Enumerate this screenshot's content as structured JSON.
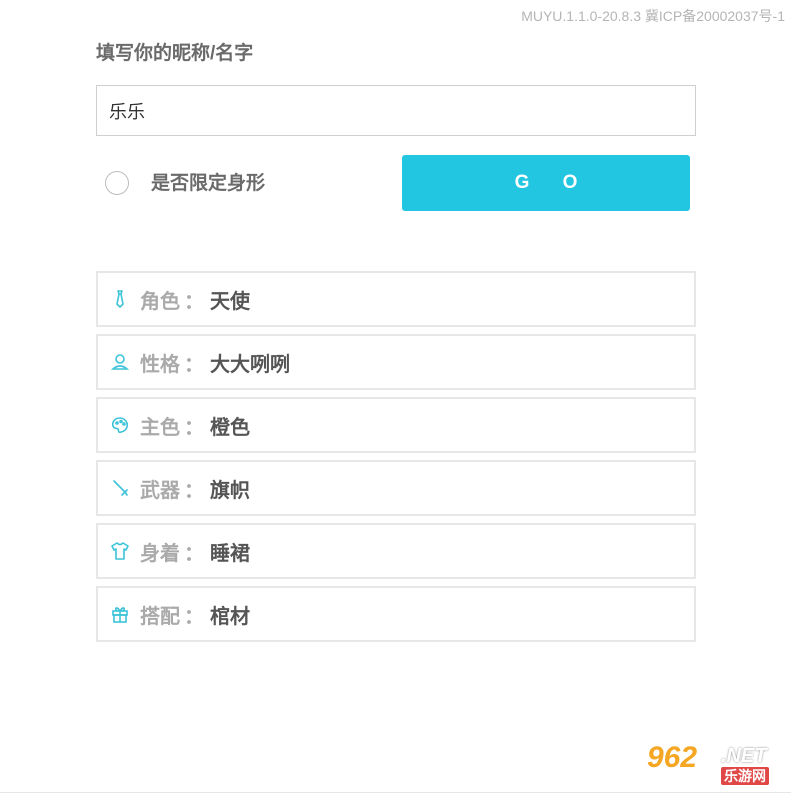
{
  "version_text": "MUYU.1.1.0-20.8.3 冀ICP备20002037号-1",
  "form": {
    "label": "填写你的昵称/名字",
    "name_value": "乐乐",
    "limit_label": "是否限定身形",
    "go_label": "G O"
  },
  "results": [
    {
      "icon": "tie-icon",
      "key": "角色",
      "sep": "：",
      "value": "天使"
    },
    {
      "icon": "person-icon",
      "key": "性格",
      "sep": "：",
      "value": "大大咧咧"
    },
    {
      "icon": "palette-icon",
      "key": "主色",
      "sep": "：",
      "value": "橙色"
    },
    {
      "icon": "sword-icon",
      "key": "武器",
      "sep": "：",
      "value": "旗帜"
    },
    {
      "icon": "shirt-icon",
      "key": "身着",
      "sep": "：",
      "value": "睡裙"
    },
    {
      "icon": "gift-icon",
      "key": "搭配",
      "sep": "：",
      "value": "棺材"
    }
  ],
  "watermark": {
    "num": "962",
    "net": ".NET",
    "cn": "乐游网"
  },
  "colors": {
    "accent": "#23c6e0",
    "icon": "#3cc3d8"
  }
}
